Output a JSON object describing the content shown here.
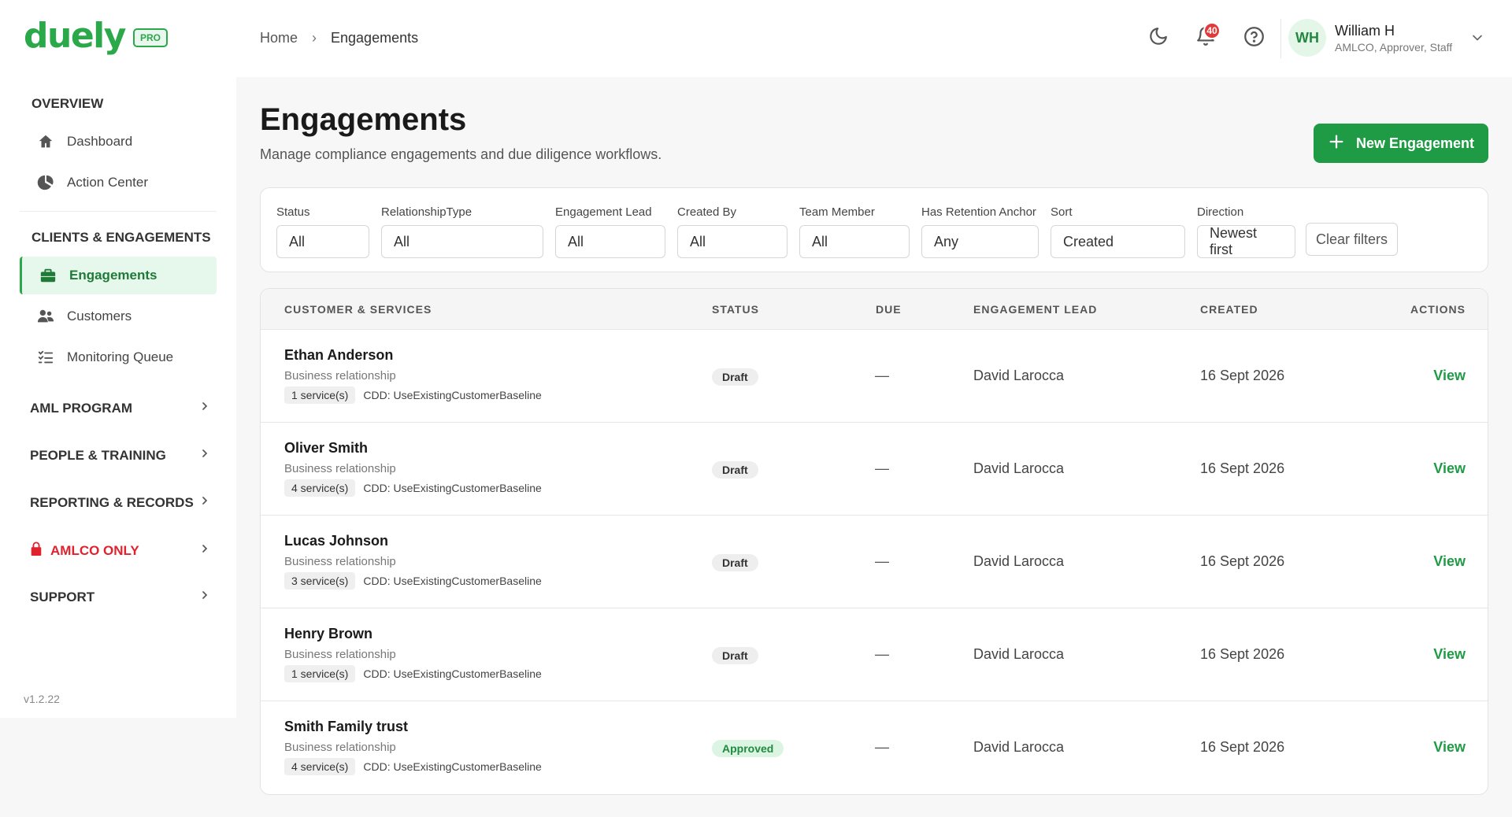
{
  "brand": {
    "name": "duely",
    "badge": "PRO",
    "color": "#2aa84a"
  },
  "breadcrumb": {
    "home": "Home",
    "separator": "›",
    "current": "Engagements"
  },
  "header": {
    "notifications_count": "40",
    "user": {
      "initials": "WH",
      "name": "William H",
      "roles": "AMLCO, Approver, Staff"
    }
  },
  "sidebar": {
    "overview_title": "OVERVIEW",
    "overview_items": [
      {
        "label": "Dashboard",
        "icon": "home-icon"
      },
      {
        "label": "Action Center",
        "icon": "pie-chart-icon"
      }
    ],
    "clients_title": "CLIENTS & ENGAGEMENTS",
    "clients_items": [
      {
        "label": "Engagements",
        "icon": "briefcase-icon",
        "active": true
      },
      {
        "label": "Customers",
        "icon": "users-icon"
      },
      {
        "label": "Monitoring Queue",
        "icon": "list-check-icon"
      }
    ],
    "groups": [
      {
        "label": "AML PROGRAM"
      },
      {
        "label": "PEOPLE & TRAINING"
      },
      {
        "label": "REPORTING & RECORDS"
      },
      {
        "label": "AMLCO ONLY",
        "icon": "lock-icon",
        "color": "#e0222f"
      },
      {
        "label": "SUPPORT"
      }
    ],
    "version": "v1.2.22"
  },
  "main": {
    "title": "Engagements",
    "subtitle": "Manage compliance engagements and due diligence workflows.",
    "new_button": "New Engagement",
    "filters": [
      {
        "label": "Status",
        "value": "All"
      },
      {
        "label": "RelationshipType",
        "value": "All"
      },
      {
        "label": "Engagement Lead",
        "value": "All"
      },
      {
        "label": "Created By",
        "value": "All"
      },
      {
        "label": "Team Member",
        "value": "All"
      },
      {
        "label": "Has Retention Anchor",
        "value": "Any"
      },
      {
        "label": "Sort",
        "value": "Created"
      },
      {
        "label": "Direction",
        "value": "Newest first"
      }
    ],
    "clear_filters": "Clear filters"
  },
  "table": {
    "columns": [
      "CUSTOMER & SERVICES",
      "STATUS",
      "DUE",
      "ENGAGEMENT LEAD",
      "CREATED",
      "ACTIONS"
    ],
    "rows": [
      {
        "name": "Ethan Anderson",
        "type": "Business relationship",
        "services": "1 service(s)",
        "cdd": "CDD: UseExistingCustomerBaseline",
        "status": "Draft",
        "due": "—",
        "lead": "David Larocca",
        "created": "16 Sept 2026",
        "action": "View"
      },
      {
        "name": "Oliver Smith",
        "type": "Business relationship",
        "services": "4 service(s)",
        "cdd": "CDD: UseExistingCustomerBaseline",
        "status": "Draft",
        "due": "—",
        "lead": "David Larocca",
        "created": "16 Sept 2026",
        "action": "View"
      },
      {
        "name": "Lucas Johnson",
        "type": "Business relationship",
        "services": "3 service(s)",
        "cdd": "CDD: UseExistingCustomerBaseline",
        "status": "Draft",
        "due": "—",
        "lead": "David Larocca",
        "created": "16 Sept 2026",
        "action": "View"
      },
      {
        "name": "Henry Brown",
        "type": "Business relationship",
        "services": "1 service(s)",
        "cdd": "CDD: UseExistingCustomerBaseline",
        "status": "Draft",
        "due": "—",
        "lead": "David Larocca",
        "created": "16 Sept 2026",
        "action": "View"
      },
      {
        "name": "Smith Family trust",
        "type": "Business relationship",
        "services": "4 service(s)",
        "cdd": "CDD: UseExistingCustomerBaseline",
        "status": "Approved",
        "due": "—",
        "lead": "David Larocca",
        "created": "16 Sept 2026",
        "action": "View"
      }
    ]
  },
  "colors": {
    "accent": "#1f9a45",
    "approved_bg": "#dcf5e3",
    "danger": "#e0222f"
  }
}
